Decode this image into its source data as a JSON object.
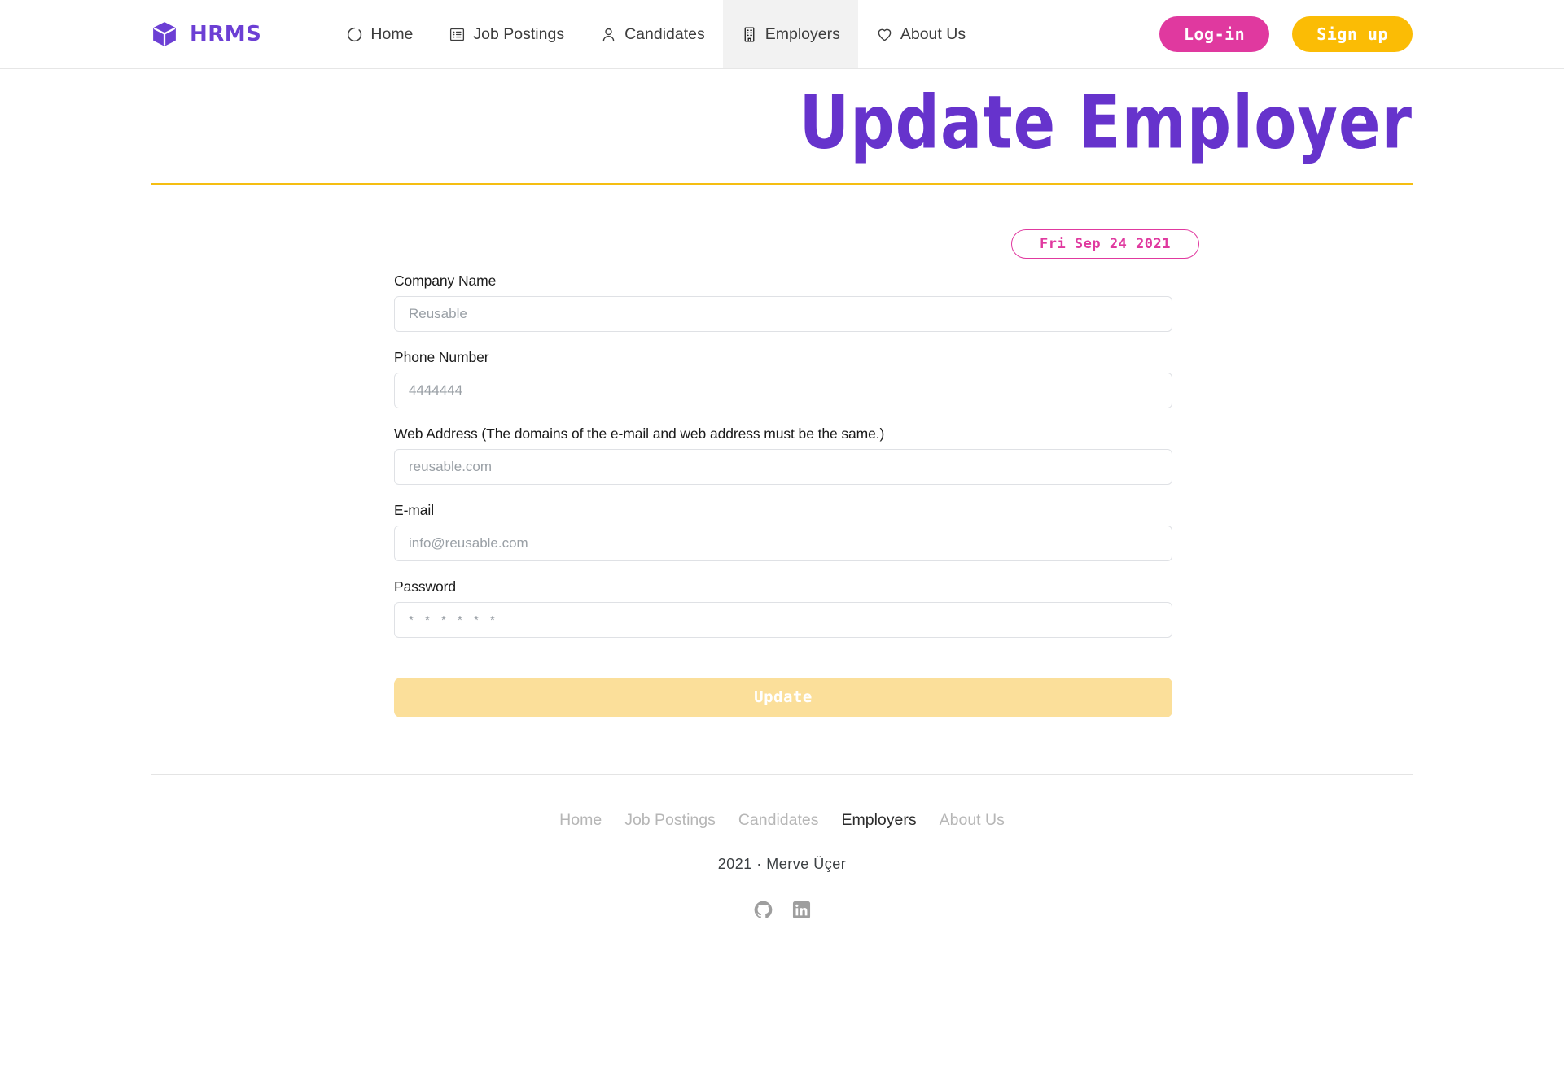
{
  "header": {
    "brand": {
      "label": "HRMS",
      "icon": "cube-icon",
      "color": "#6c3fd4"
    },
    "nav": [
      {
        "label": "Home",
        "icon": "circle-icon",
        "active": false
      },
      {
        "label": "Job Postings",
        "icon": "list-icon",
        "active": false
      },
      {
        "label": "Candidates",
        "icon": "user-icon",
        "active": false
      },
      {
        "label": "Employers",
        "icon": "building-icon",
        "active": true
      },
      {
        "label": "About Us",
        "icon": "heart-icon",
        "active": false
      }
    ],
    "login_label": "Log-in",
    "signup_label": "Sign up",
    "login_color": "#e0399f",
    "signup_color": "#fbbc05"
  },
  "page": {
    "title": "Update Employer",
    "title_color": "#6633cc",
    "rule_color": "#f5be12",
    "date_badge": "Fri Sep 24 2021",
    "date_color": "#e0399f"
  },
  "form": {
    "fields": [
      {
        "label": "Company Name",
        "placeholder": "Reusable",
        "value": "",
        "type": "text"
      },
      {
        "label": "Phone Number",
        "placeholder": "4444444",
        "value": "",
        "type": "text"
      },
      {
        "label": "Web Address (The domains of the e-mail and web address must be the same.)",
        "placeholder": "reusable.com",
        "value": "",
        "type": "text"
      },
      {
        "label": "E-mail",
        "placeholder": "info@reusable.com",
        "value": "",
        "type": "text"
      },
      {
        "label": "Password",
        "placeholder": "* * * * * *",
        "value": "",
        "type": "password"
      }
    ],
    "submit_label": "Update",
    "submit_color": "#fbdf9a"
  },
  "footer": {
    "nav": [
      {
        "label": "Home",
        "active": false
      },
      {
        "label": "Job Postings",
        "active": false
      },
      {
        "label": "Candidates",
        "active": false
      },
      {
        "label": "Employers",
        "active": true
      },
      {
        "label": "About Us",
        "active": false
      }
    ],
    "copyright": "2021  ·  Merve Üçer",
    "social": [
      {
        "name": "github-icon"
      },
      {
        "name": "linkedin-icon"
      }
    ]
  }
}
